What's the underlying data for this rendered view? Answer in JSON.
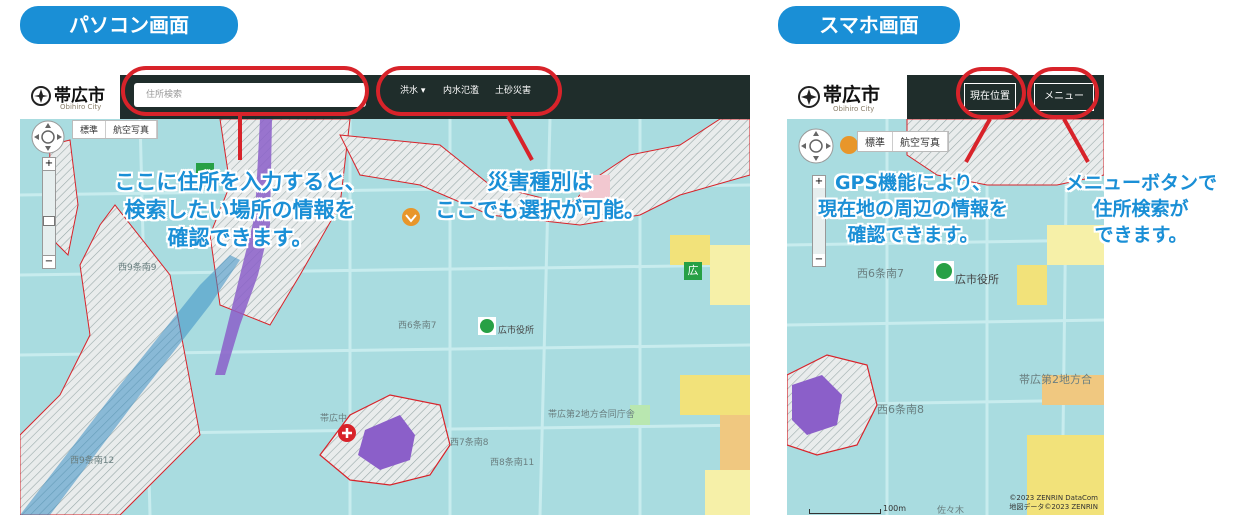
{
  "pc": {
    "heading": "パソコン画面",
    "logo": "帯広市",
    "logo_sub": "Obihiro City",
    "search_placeholder": "住所検索",
    "nav": [
      "洪水 ▾",
      "内水氾濫",
      "土砂災害"
    ],
    "map_tabs": [
      "標準",
      "航空写真"
    ],
    "annotation_search": [
      "ここに住所を入力すると、",
      "検索したい場所の情報を",
      "確認できます。"
    ],
    "annotation_disaster": [
      "災害種別は",
      "ここでも選択が可能。"
    ],
    "map_labels": [
      "西6条南7",
      "広市役所",
      "帯広第2地方合同庁舎",
      "西9条南9",
      "西7条南8",
      "西8条南11",
      "帯広中",
      "西9条南12",
      "広"
    ]
  },
  "sp": {
    "heading": "スマホ画面",
    "logo": "帯広市",
    "logo_sub": "Obihiro City",
    "location_button": "現在位置",
    "menu_button": "メニュー",
    "map_tabs": [
      "標準",
      "航空写真"
    ],
    "annotation_gps": [
      "GPS機能により、",
      "現在地の周辺の情報を",
      "確認できます。"
    ],
    "annotation_menu": [
      "メニューボタンで",
      "住所検索が",
      "できます。"
    ],
    "map_labels": [
      "西6条南7",
      "広市役所",
      "帯広第2地方合",
      "西6条南8",
      "佐々木"
    ],
    "scale": "100m",
    "credits": [
      "©2023 ZENRIN DataCom",
      "地図データ©2023 ZENRIN"
    ]
  },
  "colors": {
    "accent": "#1a8fd6",
    "highlight_ring": "#d8232a",
    "topbar": "#1f2d2b",
    "map_base": "#a9dce0",
    "flood_purple": "#8b5fc9",
    "hazard_yellow": "#f2e27a"
  }
}
